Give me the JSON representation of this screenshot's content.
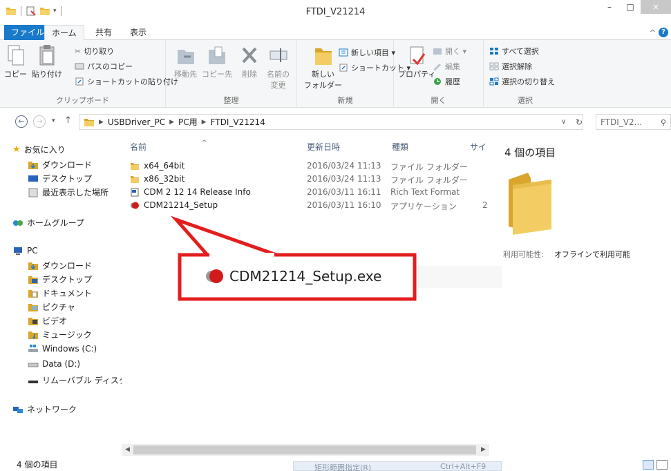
{
  "window": {
    "title": "FTDI_V21214",
    "min_label": "–",
    "max_label": "□",
    "close_label": "×"
  },
  "ribbon_tabs": [
    "ファイル",
    "ホーム",
    "共有",
    "表示"
  ],
  "ribbon": {
    "clipboard": {
      "copy": "コピー",
      "paste": "貼り付け",
      "cut": "切り取り",
      "copy_path": "パスのコピー",
      "paste_shortcut": "ショートカットの貼り付け",
      "label": "クリップボード"
    },
    "organize": {
      "move_to": "移動先",
      "copy_to": "コピー先",
      "delete": "削除",
      "rename_1": "名前の",
      "rename_2": "変更",
      "label": "整理"
    },
    "new": {
      "new_folder_1": "新しい",
      "new_folder_2": "フォルダー",
      "new_item": "新しい項目 ▾",
      "easy_access": "ショートカット ▾",
      "label": "新規"
    },
    "open": {
      "properties": "プロパティ",
      "open": "開く ▾",
      "edit": "編集",
      "history": "履歴",
      "label": "開く"
    },
    "select": {
      "select_all": "すべて選択",
      "select_none": "選択解除",
      "invert": "選択の切り替え",
      "label": "選択"
    }
  },
  "address": {
    "crumbs": [
      "USBDriver_PC",
      "PC用",
      "FTDI_V21214"
    ],
    "search_placeholder": "FTDI_V2..."
  },
  "nav_pane": {
    "favorites": "お気に入り",
    "downloads": "ダウンロード",
    "desktop": "デスクトップ",
    "recent": "最近表示した場所",
    "homegroup": "ホームグループ",
    "pc": "PC",
    "pc_downloads": "ダウンロード",
    "pc_desktop": "デスクトップ",
    "documents": "ドキュメント",
    "pictures": "ピクチャ",
    "videos": "ビデオ",
    "music": "ミュージック",
    "drive_c": "Windows (C:)",
    "drive_d": "Data (D:)",
    "removable": "リムーバブル ディスク (E",
    "network": "ネットワーク"
  },
  "columns": {
    "name": "名前",
    "modified": "更新日時",
    "type": "種類",
    "size": "サイ"
  },
  "files": [
    {
      "name": "x64_64bit",
      "modified": "2016/03/24 11:13",
      "type": "ファイル フォルダー",
      "size": "",
      "kind": "folder"
    },
    {
      "name": "x86_32bit",
      "modified": "2016/03/24 11:13",
      "type": "ファイル フォルダー",
      "size": "",
      "kind": "folder"
    },
    {
      "name": "CDM 2 12 14 Release Info",
      "modified": "2016/03/11 16:11",
      "type": "Rich Text Format",
      "size": "",
      "kind": "rtf"
    },
    {
      "name": "CDM21214_Setup",
      "modified": "2016/03/11 16:10",
      "type": "アプリケーション",
      "size": "2",
      "kind": "exe"
    }
  ],
  "details": {
    "count": "4 個の項目",
    "availability_label": "利用可能性:",
    "availability_value": "オフラインで利用可能"
  },
  "status": {
    "count": "4 個の項目",
    "tip_left": "矩形範囲指定(R)",
    "tip_right": "Ctrl+Alt+F9"
  },
  "callout": {
    "text": "CDM21214_Setup.exe",
    "color": "#e31e1e"
  }
}
